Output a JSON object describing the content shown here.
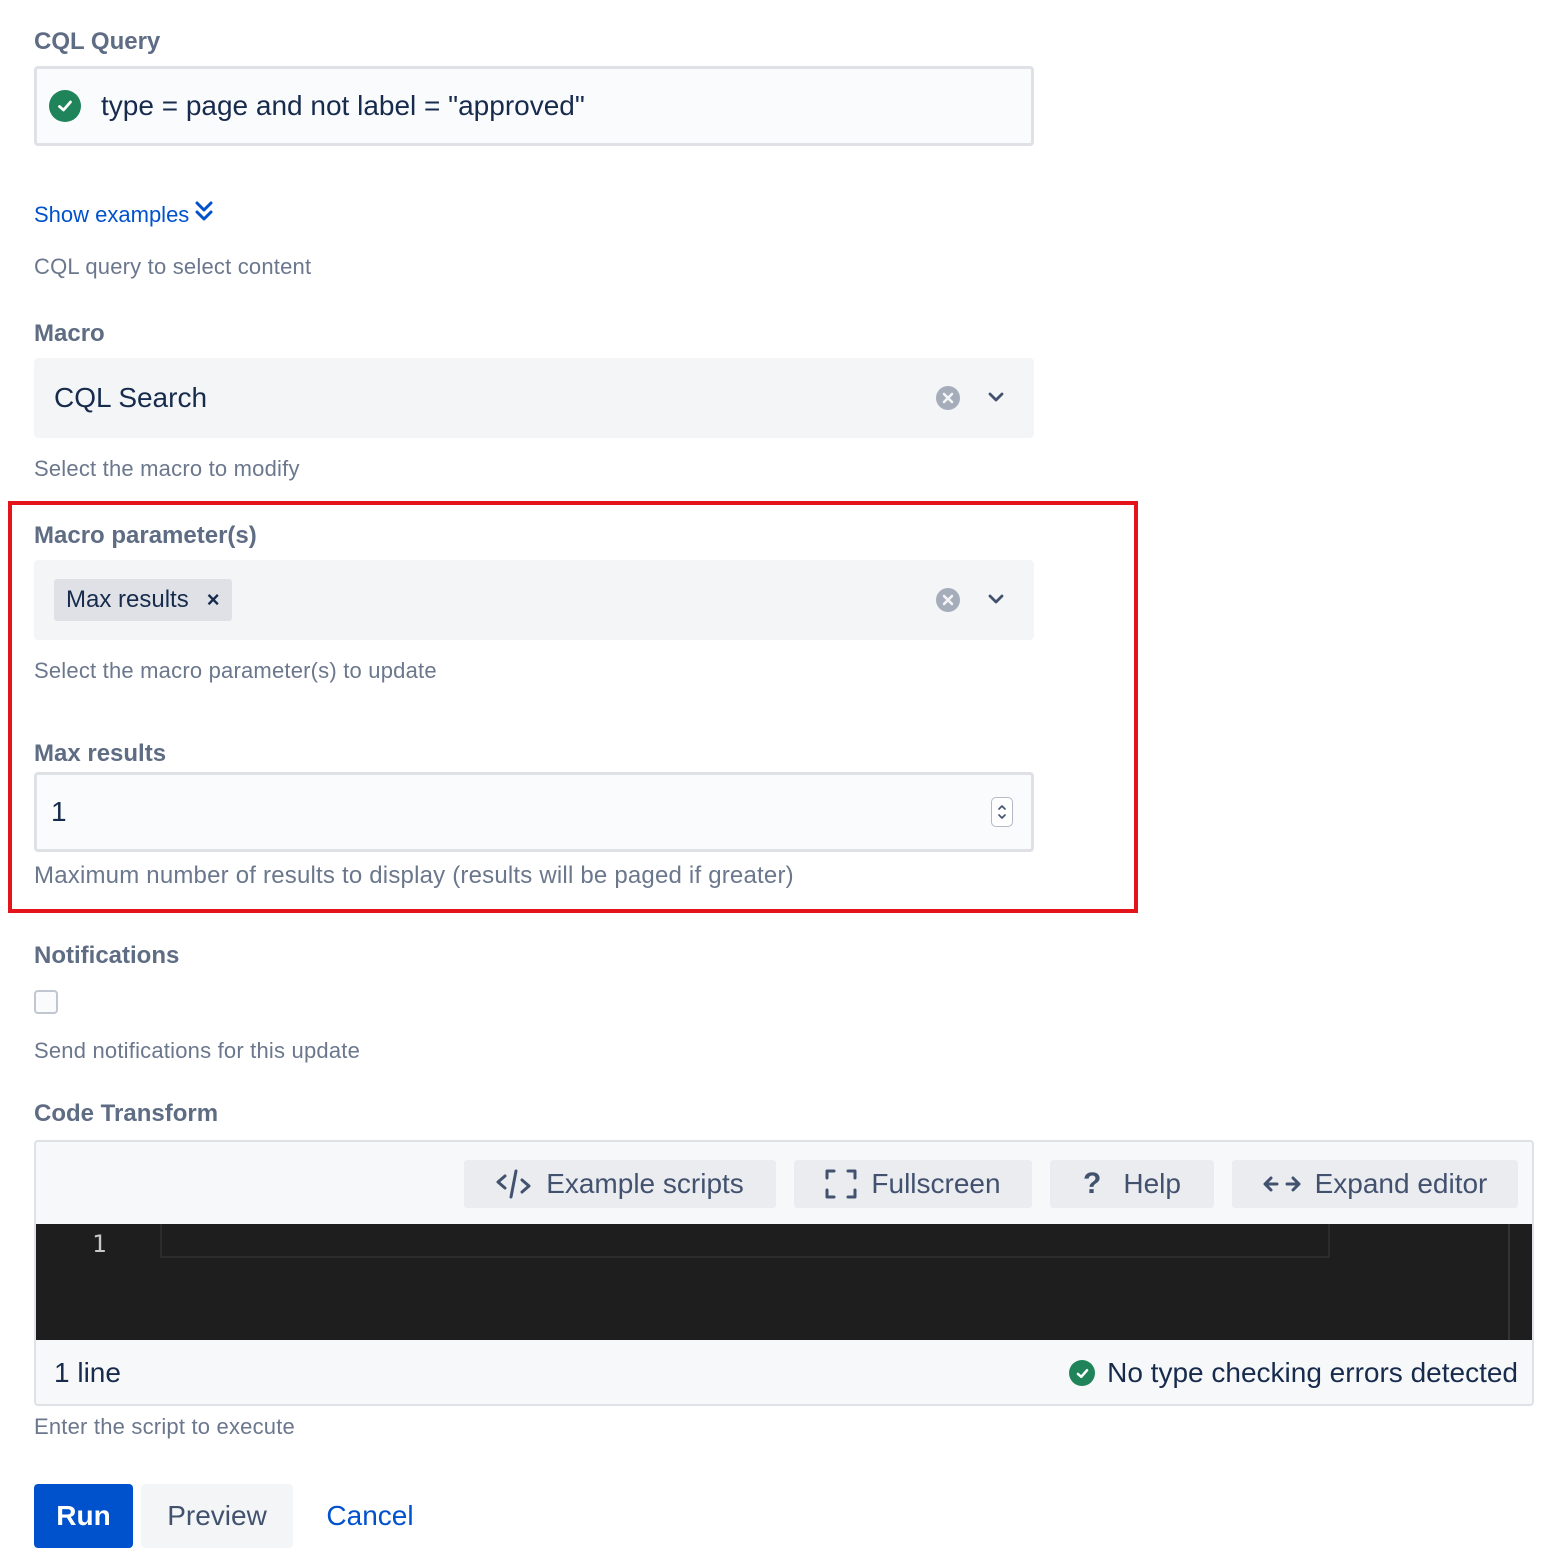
{
  "cql": {
    "label": "CQL Query",
    "value": "type = page and not label = \"approved\"",
    "show_examples": "Show examples",
    "help": "CQL query to select content"
  },
  "macro": {
    "label": "Macro",
    "value": "CQL Search",
    "help": "Select the macro to modify"
  },
  "macro_params": {
    "label": "Macro parameter(s)",
    "chips": [
      "Max results"
    ],
    "chip_remove": "×",
    "help": "Select the macro parameter(s) to update"
  },
  "max_results": {
    "label": "Max results",
    "value": "1",
    "help": "Maximum number of results to display (results will be paged if greater)"
  },
  "notifications": {
    "label": "Notifications",
    "checked": false,
    "help": "Send notifications for this update"
  },
  "code_transform": {
    "label": "Code Transform",
    "toolbar": {
      "example_scripts": "Example scripts",
      "fullscreen": "Fullscreen",
      "help_icon": "?",
      "help": "Help",
      "expand_editor": "Expand editor"
    },
    "line_number": "1",
    "line_count": "1 line",
    "type_check_status": "No type checking errors detected",
    "help": "Enter the script to execute"
  },
  "actions": {
    "run": "Run",
    "preview": "Preview",
    "cancel": "Cancel"
  },
  "colors": {
    "primary": "#0052cc",
    "success": "#1f845a",
    "highlight": "#e3151b"
  }
}
